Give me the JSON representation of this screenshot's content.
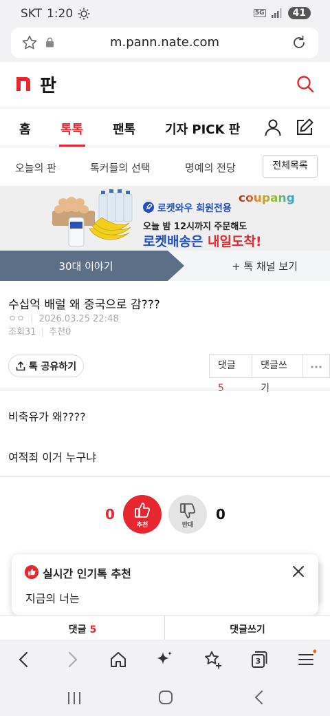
{
  "status_bar": {
    "carrier": "SKT",
    "time": "1:20",
    "network": "5G",
    "battery": "41"
  },
  "browser": {
    "url": "m.pann.nate.com"
  },
  "site": {
    "logo_text": "판"
  },
  "main_nav": {
    "items": [
      {
        "label": "홈"
      },
      {
        "label": "톡톡"
      },
      {
        "label": "팬톡"
      },
      {
        "label": "기자 PICK 판"
      }
    ]
  },
  "sub_nav": {
    "items": [
      {
        "label": "오늘의 판"
      },
      {
        "label": "톡커들의 선택"
      },
      {
        "label": "명예의 전당"
      }
    ],
    "all_button": "전체목록"
  },
  "ad": {
    "brand": "coupang",
    "line1": "로켓와우 회원전용",
    "line2": "오늘 밤 12시까지 주문해도",
    "line3_a": "로켓배송은 ",
    "line3_b": "내일도착!"
  },
  "channel": {
    "current": "30대 이야기",
    "browse": "+ 톡 채널 보기"
  },
  "post": {
    "title": "수십억 배럴 왜 중국으로 감???",
    "author": "ㅇㅇ",
    "datetime": "2026.03.25 22:48",
    "views_label": "조회",
    "views": "31",
    "recommend_label": "추천",
    "recommend": "0",
    "share_label": "톡 공유하기",
    "comments_label": "댓글",
    "comments_count": "5",
    "write_comment_label": "댓글쓰기",
    "body": [
      "비축유가 왜????",
      "여적죄 이거 누구냐"
    ]
  },
  "vote": {
    "up_count": "0",
    "up_label": "추천",
    "down_count": "0",
    "down_label": "반대"
  },
  "popup": {
    "title": "실시간 인기톡 추천",
    "text": "지금의 너는"
  },
  "bottom_bar": {
    "comments_label": "댓글",
    "comments_count": "5",
    "write_label": "댓글쓰기"
  },
  "toolbar": {
    "tabs_count": "3"
  },
  "colors": {
    "accent": "#e8262d",
    "channel_bg": "#5d6f86",
    "coupang_blue": "#1f4fc2"
  }
}
